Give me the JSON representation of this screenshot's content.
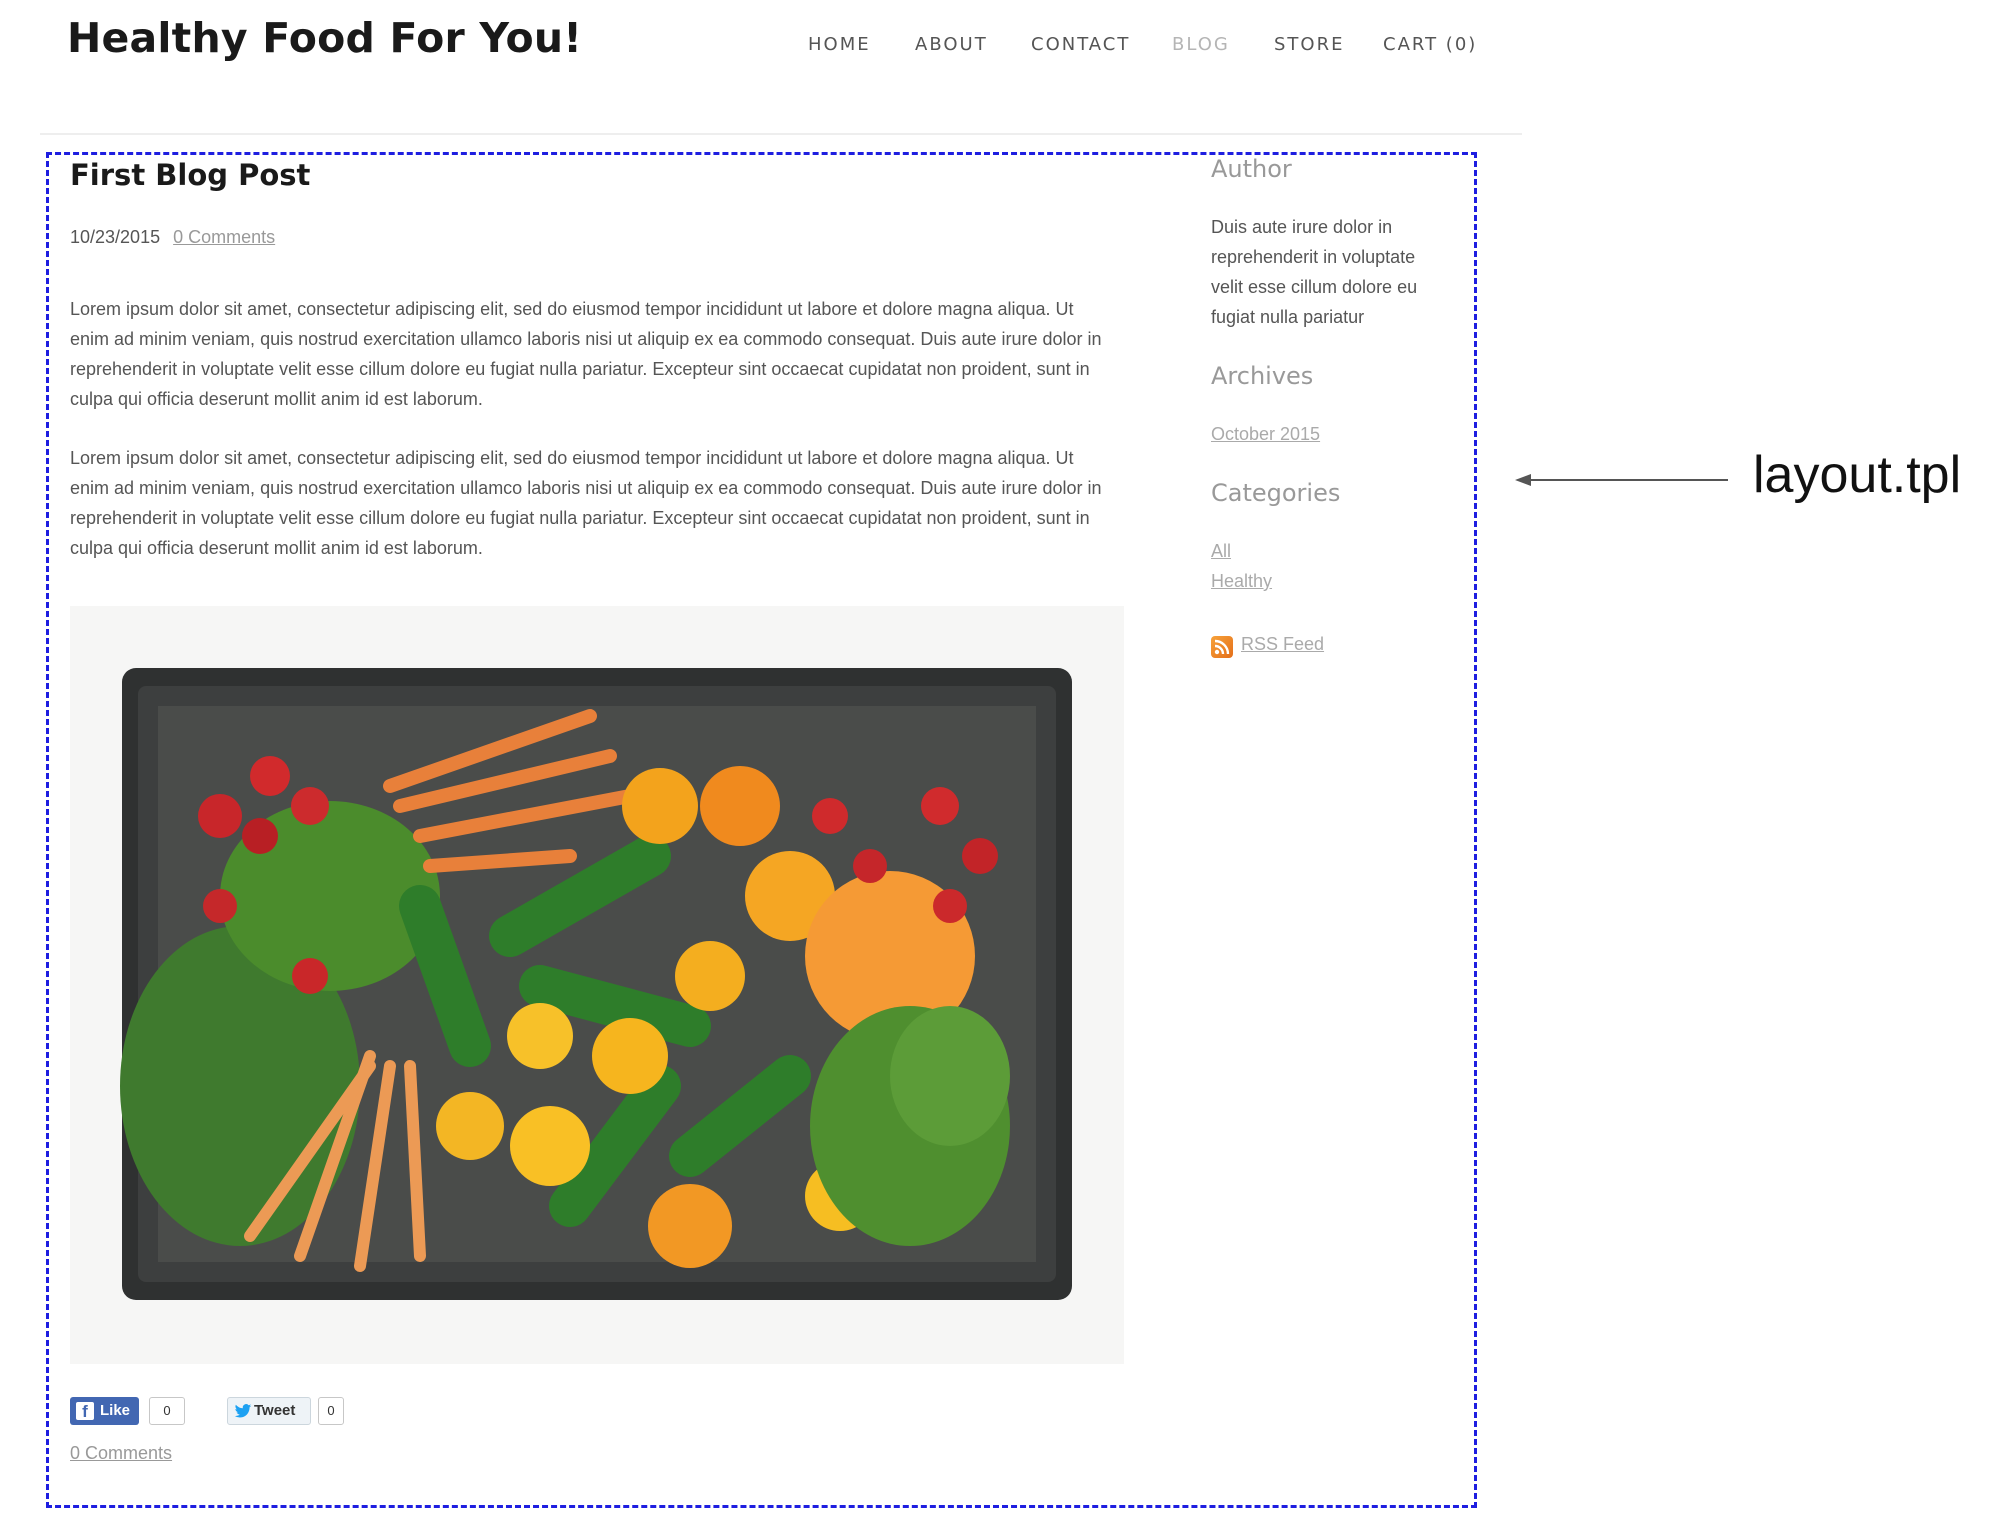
{
  "site": {
    "title": "Healthy Food For You!"
  },
  "nav": {
    "items": [
      {
        "label": "HOME"
      },
      {
        "label": "ABOUT"
      },
      {
        "label": "CONTACT"
      },
      {
        "label": "BLOG",
        "active": true
      },
      {
        "label": "STORE"
      },
      {
        "label": "CART (0)"
      }
    ]
  },
  "post": {
    "title": "First Blog Post",
    "date": "10/23/2015",
    "comments_link": "0 Comments",
    "paragraphs": [
      "Lorem ipsum dolor sit amet, consectetur adipiscing elit, sed do eiusmod tempor incididunt ut labore et dolore magna aliqua. Ut enim ad minim veniam, quis nostrud exercitation ullamco laboris nisi ut aliquip ex ea commodo consequat. Duis aute irure dolor in reprehenderit in voluptate velit esse cillum dolore eu fugiat nulla pariatur. Excepteur sint occaecat cupidatat non proident, sunt in culpa qui officia deserunt mollit anim id est laborum.",
      "Lorem ipsum dolor sit amet, consectetur adipiscing elit, sed do eiusmod tempor incididunt ut labore et dolore magna aliqua. Ut enim ad minim veniam, quis nostrud exercitation ullamco laboris nisi ut aliquip ex ea commodo consequat. Duis aute irure dolor in reprehenderit in voluptate velit esse cillum dolore eu fugiat nulla pariatur. Excepteur sint occaecat cupidatat non proident, sunt in culpa qui officia deserunt mollit anim id est laborum."
    ],
    "image_icon": "vegetable-crate-photo",
    "share": {
      "like_label": "Like",
      "like_count": "0",
      "tweet_label": "Tweet",
      "tweet_count": "0"
    },
    "footer_comments_link": "0 Comments"
  },
  "sidebar": {
    "author": {
      "heading": "Author",
      "text": "Duis aute irure dolor in reprehenderit in voluptate velit esse cillum dolore eu fugiat nulla pariatur"
    },
    "archives": {
      "heading": "Archives",
      "links": [
        "October 2015"
      ]
    },
    "categories": {
      "heading": "Categories",
      "links": [
        "All",
        "Healthy"
      ]
    },
    "rss": {
      "label": "RSS Feed",
      "icon": "rss-icon"
    }
  },
  "annotation": {
    "label": "layout.tpl",
    "box_color": "#1e1ee0"
  },
  "colors": {
    "facebook": "#4267b2",
    "twitter": "#1da1f2",
    "rss": "#f7a23a"
  }
}
